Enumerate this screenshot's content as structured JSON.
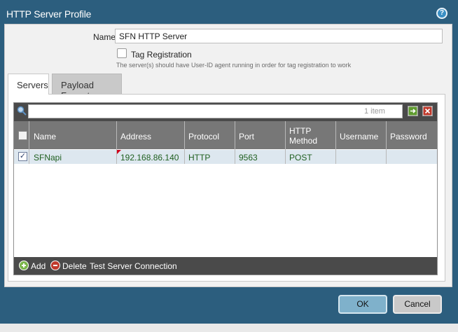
{
  "dialog": {
    "title": "HTTP Server Profile",
    "help_icon": "help-icon",
    "accent_color": "#2c5e7e"
  },
  "form": {
    "name_label": "Name",
    "name_value": "SFN HTTP Server",
    "tag_registration": {
      "label": "Tag Registration",
      "checked": false,
      "hint": "The server(s) should have User-ID agent running in order for tag registration to work"
    }
  },
  "tabs": [
    {
      "label": "Servers",
      "active": true
    },
    {
      "label": "Payload Format",
      "active": false
    }
  ],
  "grid": {
    "filter_value": "",
    "item_count": "1 item",
    "columns": [
      "Name",
      "Address",
      "Protocol",
      "Port",
      "HTTP Method",
      "Username",
      "Password"
    ],
    "rows": [
      {
        "checked": true,
        "name": "SFNapi",
        "address": "192.168.86.140",
        "protocol": "HTTP",
        "port": "9563",
        "http_method": "POST",
        "username": "",
        "password": ""
      }
    ],
    "actions": {
      "add": "Add",
      "delete": "Delete",
      "test": "Test Server Connection"
    }
  },
  "buttons": {
    "ok": "OK",
    "cancel": "Cancel"
  },
  "icons": {
    "search": "search-icon",
    "apply_filter": "apply-filter-icon",
    "clear_filter": "clear-filter-icon",
    "add": "add-icon",
    "delete": "delete-icon",
    "error_flag": "error-flag-icon"
  }
}
